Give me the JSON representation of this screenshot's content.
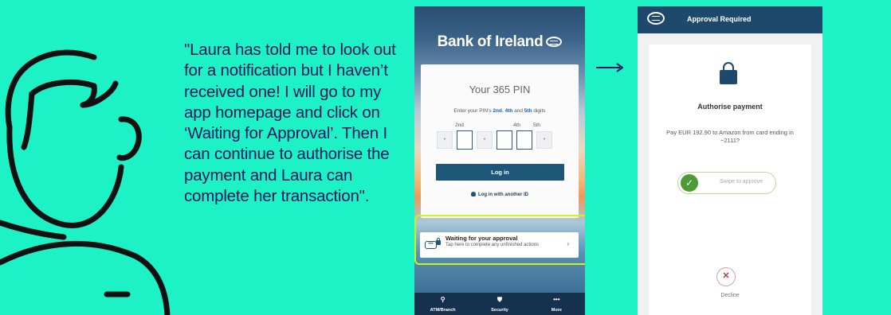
{
  "quote": "\"Laura has told me to look out for a notification but I haven’t received one! I will go to my app homepage and click on ‘Waiting for Approval’. Then I can continue to authorise the payment and Laura can complete her transaction\".",
  "colors": {
    "background": "#1df2c6",
    "text": "#15185a",
    "highlight": "#c8f41f",
    "brand": "#1d4a6c"
  },
  "phone1": {
    "bank_name": "Bank of Ireland",
    "pin_title": "Your 365 PIN",
    "pin_instruction_pre": "Enter your PIN's ",
    "pin_instruction_d1": "2nd",
    "pin_instruction_sep1": ", ",
    "pin_instruction_d2": "4th",
    "pin_instruction_sep2": " and ",
    "pin_instruction_d3": "5th",
    "pin_instruction_post": " digits",
    "digit_labels": [
      "2nd",
      "4th",
      "5th"
    ],
    "masked_digit": "•",
    "login_label": "Log in",
    "another_id_label": "Log in with another ID",
    "approval": {
      "title": "Waiting for your approval",
      "subtitle": "Tap here to complete any unfinished actions",
      "icon_text": "•••",
      "chevron": "›"
    },
    "nav": [
      {
        "label": "ATM/Branch",
        "icon": "location-pin-icon",
        "glyph": "⚲"
      },
      {
        "label": "Security",
        "icon": "shield-icon",
        "glyph": "⛊"
      },
      {
        "label": "More",
        "icon": "more-dots-icon",
        "glyph": "•••"
      }
    ]
  },
  "phone2": {
    "header_title": "Approval Required",
    "auth_title": "Authorise payment",
    "auth_description": "Pay EUR 192.90 to Amazon from card ending in ~2111?",
    "swipe_label": "Swipe to approve",
    "swipe_glyph": "✓",
    "decline_label": "Decline",
    "decline_glyph": "✕"
  }
}
